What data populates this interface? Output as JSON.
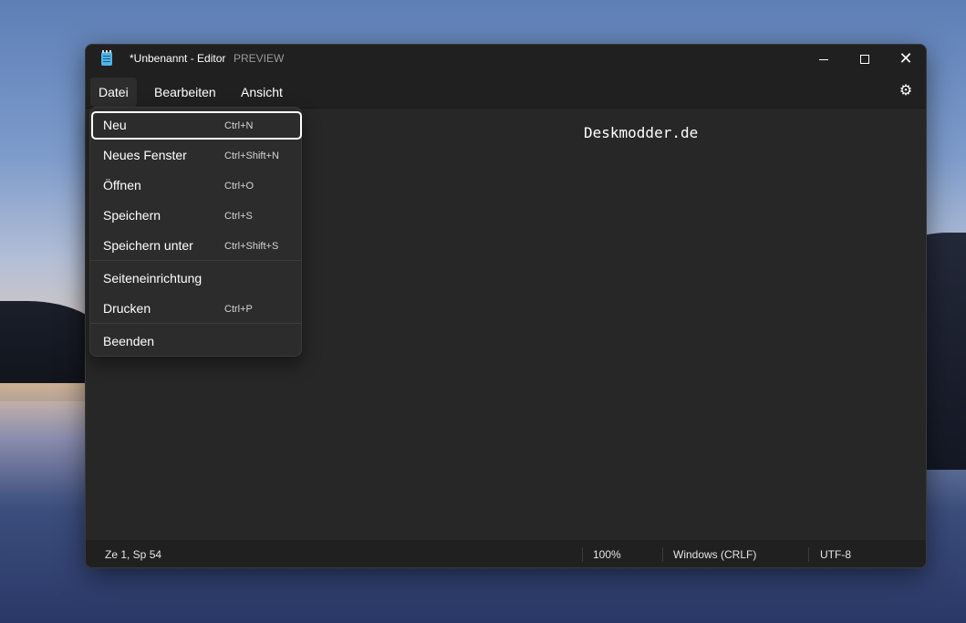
{
  "window": {
    "title": "*Unbenannt - Editor",
    "preview_label": "PREVIEW"
  },
  "menubar": {
    "items": [
      {
        "label": "Datei"
      },
      {
        "label": "Bearbeiten"
      },
      {
        "label": "Ansicht"
      }
    ],
    "settings_icon": "gear-icon"
  },
  "editor": {
    "content": "Deskmodder.de"
  },
  "file_menu": {
    "items": [
      {
        "label": "Neu",
        "shortcut": "Ctrl+N"
      },
      {
        "label": "Neues Fenster",
        "shortcut": "Ctrl+Shift+N"
      },
      {
        "label": "Öffnen",
        "shortcut": "Ctrl+O"
      },
      {
        "label": "Speichern",
        "shortcut": "Ctrl+S"
      },
      {
        "label": "Speichern unter",
        "shortcut": "Ctrl+Shift+S"
      },
      {
        "label": "Seiteneinrichtung",
        "shortcut": ""
      },
      {
        "label": "Drucken",
        "shortcut": "Ctrl+P"
      },
      {
        "label": "Beenden",
        "shortcut": ""
      }
    ]
  },
  "statusbar": {
    "position": "Ze 1, Sp 54",
    "zoom": "100%",
    "line_ending": "Windows (CRLF)",
    "encoding": "UTF-8"
  }
}
